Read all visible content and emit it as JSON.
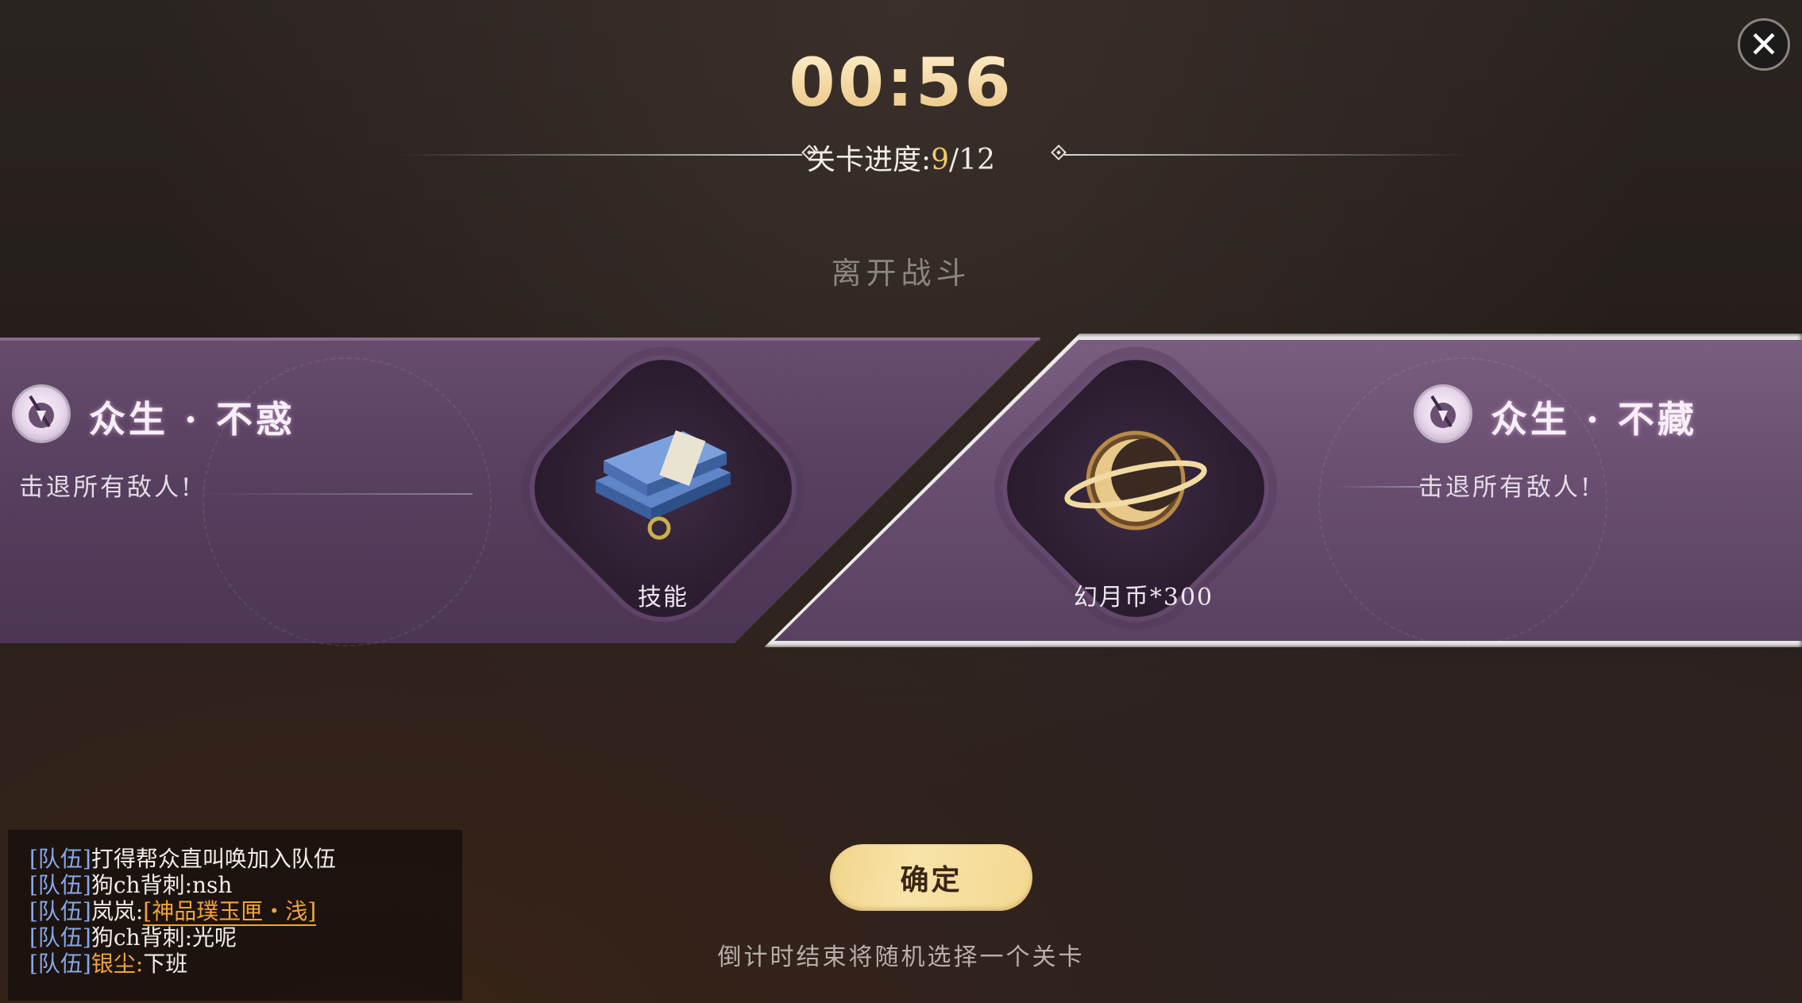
{
  "timer": "00:56",
  "progress": {
    "label": "关卡进度:",
    "current": "9",
    "total": "/12"
  },
  "leave_battle": "离开战斗",
  "stages": [
    {
      "title": "众生 · 不惑",
      "desc": "击退所有敌人!",
      "reward": "技能",
      "reward_icon": "skill-books-icon"
    },
    {
      "title": "众生 · 不藏",
      "desc": "击退所有敌人!",
      "reward": "幻月币*300",
      "reward_icon": "moon-coin-icon",
      "selected": true
    }
  ],
  "confirm_label": "确定",
  "hint": "倒计时结束将随机选择一个关卡",
  "chat": [
    {
      "channel": "[队伍]",
      "name": "",
      "text": "打得帮众直叫唤加入队伍"
    },
    {
      "channel": "[队伍]",
      "name": "狗ch背刺:",
      "text": "nsh"
    },
    {
      "channel": "[队伍]",
      "name": "岚岚:",
      "text": "[神品璞玉匣・浅]",
      "highlight": true
    },
    {
      "channel": "[队伍]",
      "name": "狗ch背刺:",
      "text": "光呢"
    },
    {
      "channel": "[队伍]",
      "name": "银尘:",
      "text": "下班",
      "name_highlight": true
    }
  ],
  "colors": {
    "timer": "#f3d9a6",
    "progress_current": "#f3c96a",
    "band": "#6a4e72",
    "confirm": "#f5dc9c",
    "chat_channel": "#86a8e8",
    "chat_item": "#f0a53a"
  }
}
